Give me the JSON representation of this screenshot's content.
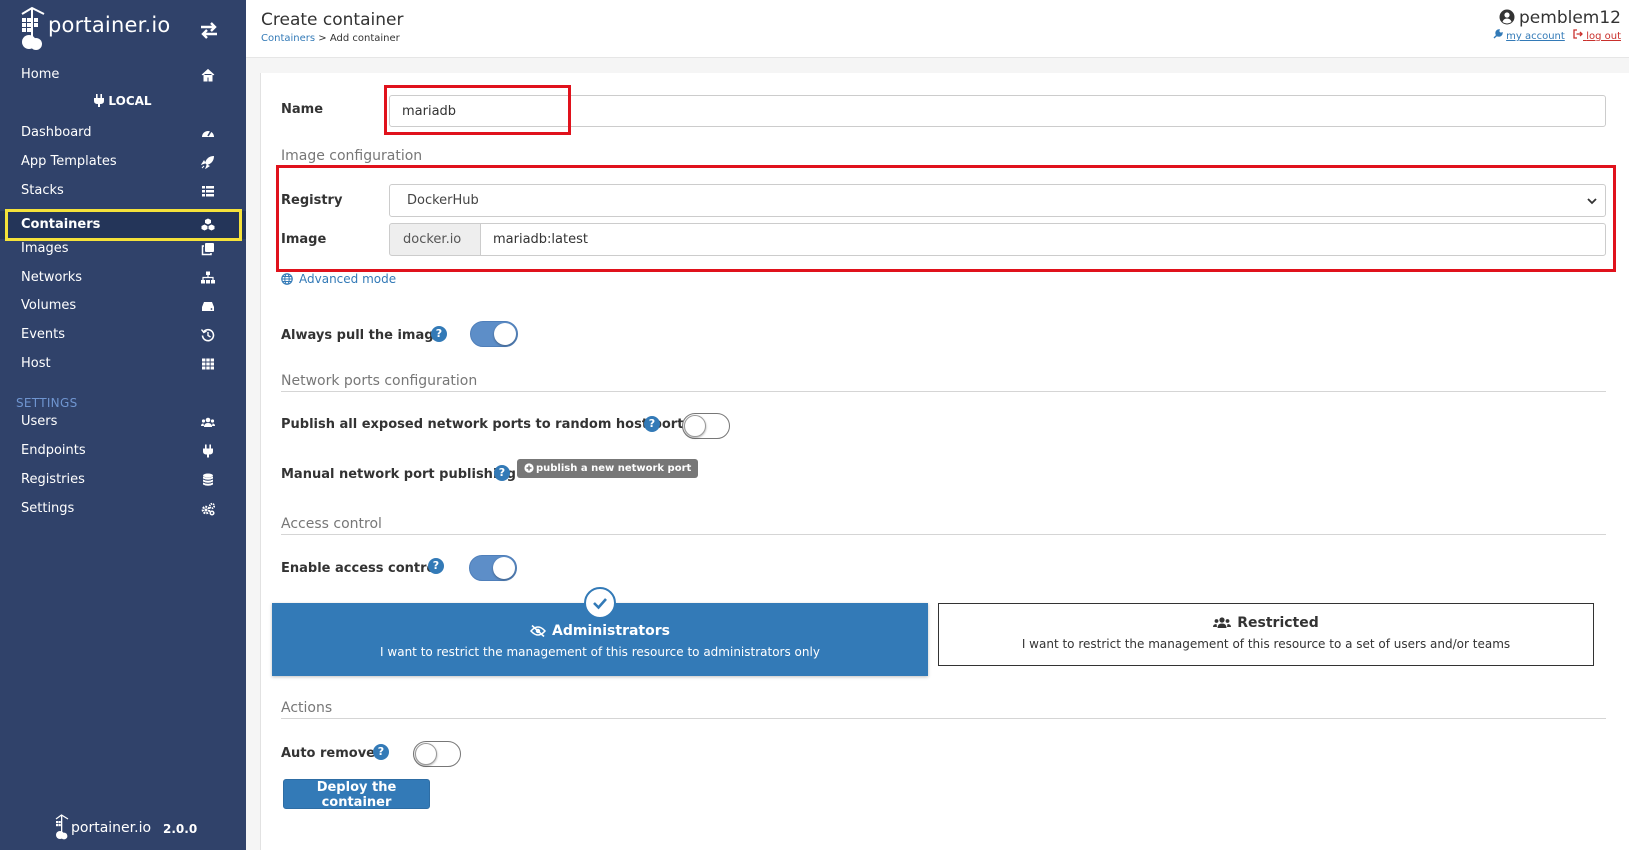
{
  "brand": {
    "name": "portainer.io",
    "version": "2.0.0"
  },
  "sidebar": {
    "home_label": "Home",
    "endpoint_label": "LOCAL",
    "items": [
      {
        "label": "Dashboard",
        "icon": "tachometer-icon"
      },
      {
        "label": "App Templates",
        "icon": "rocket-icon"
      },
      {
        "label": "Stacks",
        "icon": "th-list-icon"
      },
      {
        "label": "Containers",
        "icon": "cubes-icon",
        "active": true
      },
      {
        "label": "Images",
        "icon": "clone-icon"
      },
      {
        "label": "Networks",
        "icon": "sitemap-icon"
      },
      {
        "label": "Volumes",
        "icon": "hdd-icon"
      },
      {
        "label": "Events",
        "icon": "history-icon"
      },
      {
        "label": "Host",
        "icon": "th-icon"
      }
    ],
    "settings_header": "SETTINGS",
    "settings_items": [
      {
        "label": "Users",
        "icon": "users-icon"
      },
      {
        "label": "Endpoints",
        "icon": "plug-icon"
      },
      {
        "label": "Registries",
        "icon": "database-icon"
      },
      {
        "label": "Settings",
        "icon": "cogs-icon"
      }
    ]
  },
  "header": {
    "title": "Create container",
    "breadcrumb_link": "Containers",
    "breadcrumb_sep": " > ",
    "breadcrumb_current": "Add container",
    "username": "pemblem12",
    "my_account": "my account",
    "log_out": "log out"
  },
  "form": {
    "name_label": "Name",
    "name_value": "mariadb",
    "image_section": "Image configuration",
    "registry_label": "Registry",
    "registry_value": "DockerHub",
    "image_label": "Image",
    "image_prefix": "docker.io",
    "image_value": "mariadb:latest",
    "advanced_mode": "Advanced mode",
    "always_pull_label": "Always pull the image",
    "always_pull": true,
    "ports_section": "Network ports configuration",
    "publish_all_label": "Publish all exposed network ports to random host ports",
    "publish_all": false,
    "manual_publish_label": "Manual network port publishing",
    "publish_new_port": "publish a new network port",
    "access_section": "Access control",
    "enable_access_label": "Enable access control",
    "enable_access": true,
    "admin_title": "Administrators",
    "admin_desc": "I want to restrict the management of this resource to administrators only",
    "restricted_title": "Restricted",
    "restricted_desc": "I want to restrict the management of this resource to a set of users and/or teams",
    "actions_section": "Actions",
    "auto_remove_label": "Auto remove",
    "auto_remove": false,
    "deploy_button": "Deploy the container"
  },
  "colors": {
    "sidebar_bg": "#30426a",
    "primary": "#337ab7",
    "highlight_yellow": "#f5e23a",
    "highlight_red": "#e0121c"
  }
}
